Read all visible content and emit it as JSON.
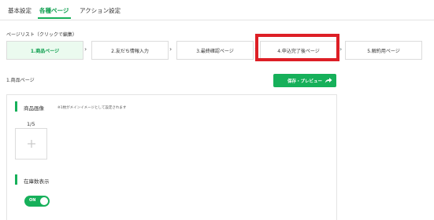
{
  "tabs": [
    {
      "label": "基本設定"
    },
    {
      "label": "各種ページ"
    },
    {
      "label": "アクション設定"
    }
  ],
  "active_tab": "各種ページ",
  "page_list": {
    "label": "ページリスト（クリックで編集）",
    "steps": [
      {
        "label": "1.商品ページ",
        "active": true
      },
      {
        "label": "2.友だち情報入力",
        "active": false
      },
      {
        "label": "3.最終確認ページ",
        "active": false
      },
      {
        "label": "4.申込完了後ページ",
        "active": false
      },
      {
        "label": "5.解約用ページ",
        "active": false
      }
    ],
    "highlighted_step": "4.申込完了後ページ"
  },
  "section": {
    "title": "1.商品ページ",
    "save_label": "保存・プレビュー"
  },
  "card": {
    "image_label": "商品画像",
    "image_note": "※1枚がメインイメージとして設定されます",
    "image_counter": "1/5",
    "stock_label": "在庫数表示",
    "toggle_label": "ON"
  },
  "colors": {
    "accent": "#16b05a",
    "highlight": "#dd1f26"
  },
  "icons": {
    "step_separator": "chevron-right-icon",
    "save": "share-arrow-icon",
    "upload": "plus-icon"
  }
}
